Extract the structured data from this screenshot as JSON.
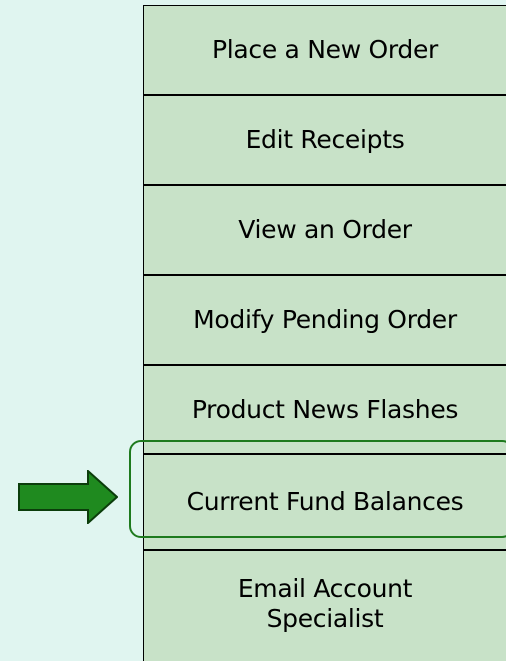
{
  "menu": {
    "items": [
      {
        "label": "Place a New Order"
      },
      {
        "label": "Edit Receipts"
      },
      {
        "label": "View an Order"
      },
      {
        "label": "Modify Pending Order"
      },
      {
        "label": "Product News Flashes"
      },
      {
        "label": "Current Fund Balances"
      },
      {
        "label_line1": "Email Account",
        "label_line2": "Specialist"
      }
    ],
    "highlighted_item": "Current Fund Balances"
  },
  "colors": {
    "background": "#e0f5f0",
    "button_fill": "#c8e2c8",
    "border": "#000000",
    "highlight": "#1e7a1e",
    "arrow_fill": "#1f8a1f",
    "arrow_outline": "#0b3d0b"
  },
  "annotation": {
    "arrow_icon": "right-arrow-icon",
    "highlight": "rounded-rectangle-outline"
  }
}
